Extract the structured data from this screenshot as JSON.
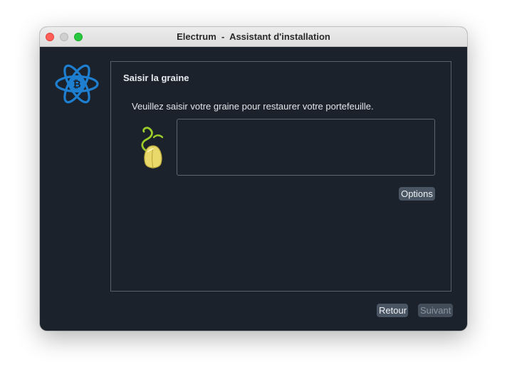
{
  "window": {
    "title": "Electrum  -  Assistant d'installation"
  },
  "panel": {
    "title": "Saisir la graine",
    "instruction": "Veuillez saisir votre graine pour restaurer votre portefeuille.",
    "seed_input": {
      "value": "",
      "placeholder": ""
    },
    "options_label": "Options"
  },
  "footer": {
    "back_label": "Retour",
    "next_label": "Suivant",
    "next_enabled": false
  },
  "icons": {
    "logo": "electrum-logo-icon",
    "seed": "seed-sprout-icon"
  },
  "colors": {
    "background": "#1b222c",
    "logo_blue": "#1e7fd0",
    "button": "#4a5563",
    "seed_yellow": "#e9d86a",
    "sprout_green": "#9ccc2a"
  }
}
